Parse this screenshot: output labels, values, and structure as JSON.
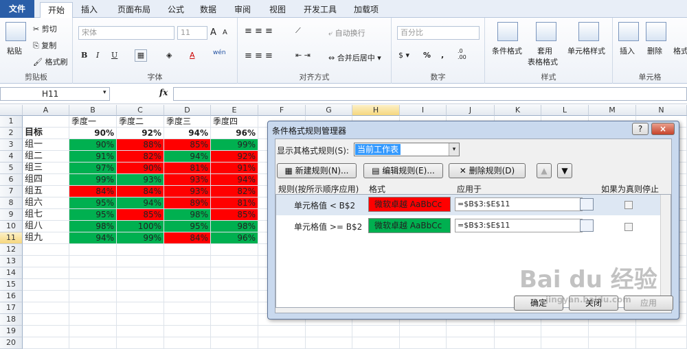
{
  "tabs": [
    "文件",
    "开始",
    "插入",
    "页面布局",
    "公式",
    "数据",
    "审阅",
    "视图",
    "开发工具",
    "加载项"
  ],
  "ribbon": {
    "clipboard": {
      "paste": "粘贴",
      "cut": "剪切",
      "copy": "复制",
      "format_painter": "格式刷",
      "label": "剪贴板"
    },
    "font": {
      "name": "宋体",
      "size": "11",
      "label": "字体",
      "bold": "B",
      "italic": "I",
      "underline": "U",
      "grow": "A",
      "shrink": "A",
      "color": "A",
      "wen": "wén"
    },
    "align": {
      "wrap": "自动换行",
      "merge": "合并后居中",
      "label": "对齐方式"
    },
    "number": {
      "format": "百分比",
      "label": "数字",
      "percent": "%",
      "comma": ","
    },
    "styles": {
      "cond": "条件格式",
      "table": "套用",
      "table2": "表格格式",
      "cell": "单元格样式",
      "label": "样式"
    },
    "cells": {
      "insert": "插入",
      "delete": "删除",
      "format": "格式",
      "label": "单元格"
    }
  },
  "formula_bar": {
    "name": "H11",
    "fx": "fx",
    "value": ""
  },
  "columns": [
    "A",
    "B",
    "C",
    "D",
    "E",
    "F",
    "G",
    "H",
    "I",
    "J",
    "K",
    "L",
    "M",
    "N"
  ],
  "rows": [
    "1",
    "2",
    "3",
    "4",
    "5",
    "6",
    "7",
    "8",
    "9",
    "10",
    "11",
    "12",
    "13",
    "14",
    "15",
    "16",
    "17",
    "18",
    "19",
    "20"
  ],
  "sheet": {
    "headers": [
      "季度一",
      "季度二",
      "季度三",
      "季度四"
    ],
    "target": {
      "label": "目标",
      "values": [
        "90%",
        "92%",
        "94%",
        "96%"
      ]
    },
    "data": [
      {
        "label": "组一",
        "values": [
          "90%",
          "88%",
          "85%",
          "99%"
        ]
      },
      {
        "label": "组二",
        "values": [
          "91%",
          "82%",
          "94%",
          "92%"
        ]
      },
      {
        "label": "组三",
        "values": [
          "97%",
          "90%",
          "81%",
          "91%"
        ]
      },
      {
        "label": "组四",
        "values": [
          "99%",
          "93%",
          "93%",
          "94%"
        ]
      },
      {
        "label": "组五",
        "values": [
          "84%",
          "84%",
          "93%",
          "82%"
        ]
      },
      {
        "label": "组六",
        "values": [
          "95%",
          "94%",
          "89%",
          "81%"
        ]
      },
      {
        "label": "组七",
        "values": [
          "95%",
          "85%",
          "98%",
          "85%"
        ]
      },
      {
        "label": "组八",
        "values": [
          "98%",
          "100%",
          "95%",
          "98%"
        ]
      },
      {
        "label": "组九",
        "values": [
          "94%",
          "99%",
          "84%",
          "96%"
        ]
      }
    ]
  },
  "colors": {
    "green": "#00b050",
    "red": "#ff0000"
  },
  "dialog": {
    "title": "条件格式规则管理器",
    "help": "?",
    "close": "×",
    "show_label": "显示其格式规则(S):",
    "show_value": "当前工作表",
    "new_rule": "新建规则(N)...",
    "edit_rule": "编辑规则(E)...",
    "delete_rule": "删除规则(D)",
    "col_rule": "规则(按所示顺序应用)",
    "col_format": "格式",
    "col_applies": "应用于",
    "col_stop": "如果为真则停止",
    "rules": [
      {
        "rule": "单元格值 < B$2",
        "preview": "微软卓越  AaBbCc",
        "applies": "=$B$3:$E$11",
        "color": "#ff0000"
      },
      {
        "rule": "单元格值 >= B$2",
        "preview": "微软卓越  AaBbCc",
        "applies": "=$B$3:$E$11",
        "color": "#00b050"
      }
    ],
    "ok": "确定",
    "close_btn": "关闭",
    "apply": "应用"
  },
  "watermark": {
    "logo": "Bai du 经验",
    "url": "jingyan.baidu.com"
  }
}
